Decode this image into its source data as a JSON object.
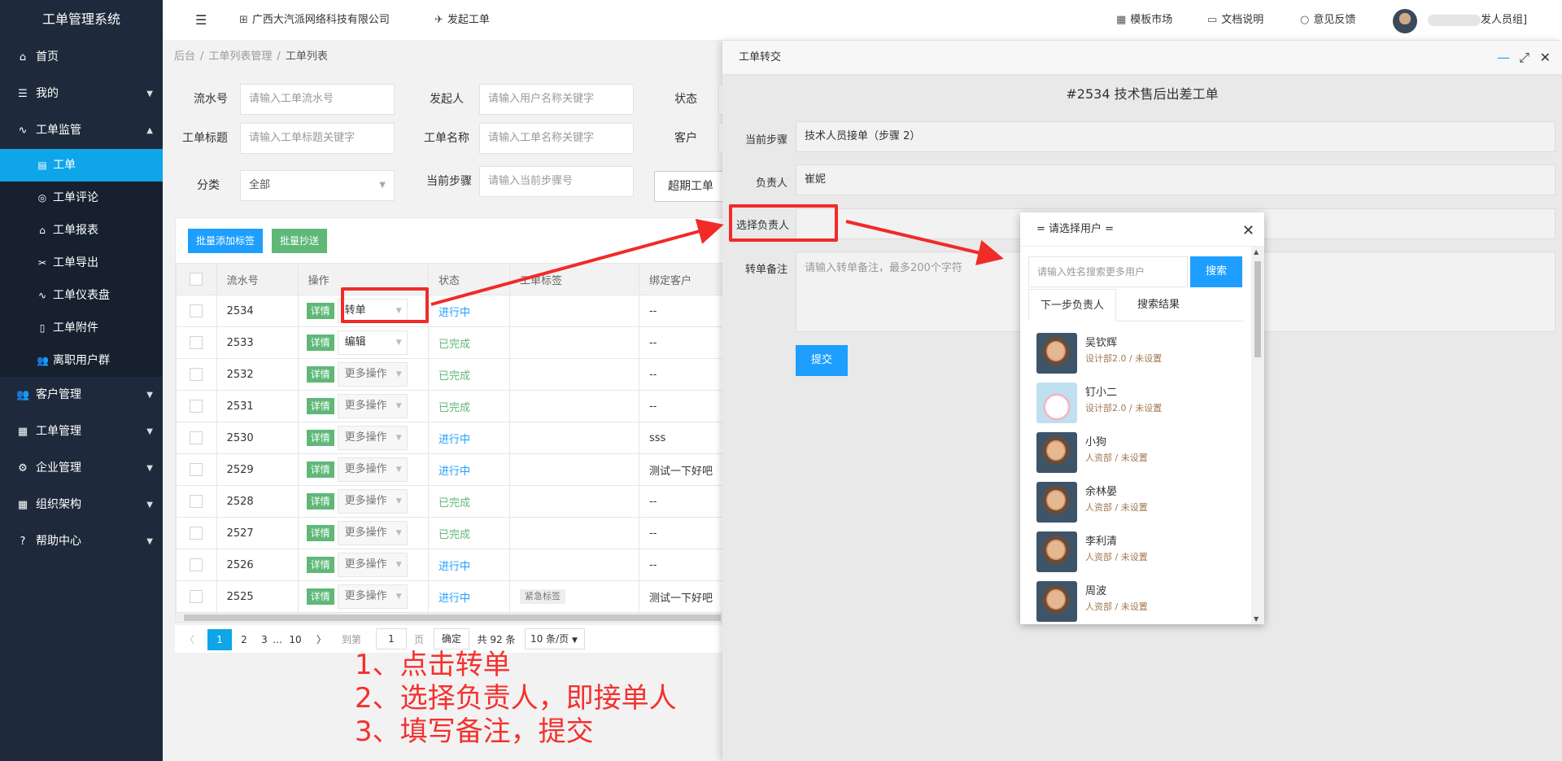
{
  "sidebar": {
    "brand": "工单管理系统",
    "items": [
      {
        "label": "首页",
        "icon": "home-icon"
      },
      {
        "label": "我的",
        "icon": "layers-icon"
      },
      {
        "label": "工单监管",
        "icon": "pulse-icon"
      },
      {
        "label": "客户管理",
        "icon": "users-icon"
      },
      {
        "label": "工单管理",
        "icon": "clipboard-icon"
      },
      {
        "label": "企业管理",
        "icon": "gear-icon"
      },
      {
        "label": "组织架构",
        "icon": "table-icon"
      },
      {
        "label": "帮助中心",
        "icon": "question-icon"
      }
    ],
    "sub_items": [
      {
        "label": "工单",
        "icon": "file-icon"
      },
      {
        "label": "工单评论",
        "icon": "comment-icon"
      },
      {
        "label": "工单报表",
        "icon": "home-icon"
      },
      {
        "label": "工单导出",
        "icon": "export-icon"
      },
      {
        "label": "工单仪表盘",
        "icon": "pulse-icon"
      },
      {
        "label": "工单附件",
        "icon": "file-icon"
      },
      {
        "label": "离职用户群",
        "icon": "users-icon"
      }
    ]
  },
  "topbar": {
    "company": "广西大汽派网络科技有限公司",
    "create": "发起工单",
    "template": "模板市场",
    "docs": "文档说明",
    "feedback": "意见反馈",
    "user": "发人员组]"
  },
  "breadcrumb": [
    "后台",
    "工单列表管理",
    "工单列表"
  ],
  "filters": {
    "serial_label": "流水号",
    "serial_ph": "请输入工单流水号",
    "initiator_label": "发起人",
    "initiator_ph": "请输入用户名称关键字",
    "status_label": "状态",
    "title_label": "工单标题",
    "title_ph": "请输入工单标题关键字",
    "name_label": "工单名称",
    "name_ph": "请输入工单名称关键字",
    "customer_label": "客户",
    "category_label": "分类",
    "category_value": "全部",
    "step_label": "当前步骤",
    "step_ph": "请输入当前步骤号",
    "overdue_btn": "超期工单"
  },
  "toolbar": {
    "add_tag": "批量添加标签",
    "cc": "批量抄送"
  },
  "table": {
    "headers": [
      "流水号",
      "操作",
      "状态",
      "工单标签",
      "绑定客户"
    ],
    "detail_label": "详情",
    "rows": [
      {
        "id": "2534",
        "op": "转单",
        "status": "进行中",
        "tag": "",
        "customer": "--"
      },
      {
        "id": "2533",
        "op": "编辑",
        "status": "已完成",
        "tag": "",
        "customer": "--"
      },
      {
        "id": "2532",
        "op": "更多操作",
        "status": "已完成",
        "tag": "",
        "customer": "--"
      },
      {
        "id": "2531",
        "op": "更多操作",
        "status": "已完成",
        "tag": "",
        "customer": "--"
      },
      {
        "id": "2530",
        "op": "更多操作",
        "status": "进行中",
        "tag": "",
        "customer": "sss"
      },
      {
        "id": "2529",
        "op": "更多操作",
        "status": "进行中",
        "tag": "",
        "customer": "测试一下好吧"
      },
      {
        "id": "2528",
        "op": "更多操作",
        "status": "已完成",
        "tag": "",
        "customer": "--"
      },
      {
        "id": "2527",
        "op": "更多操作",
        "status": "已完成",
        "tag": "",
        "customer": "--"
      },
      {
        "id": "2526",
        "op": "更多操作",
        "status": "进行中",
        "tag": "",
        "customer": "--"
      },
      {
        "id": "2525",
        "op": "更多操作",
        "status": "进行中",
        "tag": "紧急标签",
        "customer": "测试一下好吧"
      }
    ]
  },
  "pager": {
    "prev": "〈",
    "p1": "1",
    "p2": "2",
    "p3": "3",
    "ellipsis": "…",
    "p10": "10",
    "next": "〉",
    "goto": "到第",
    "goto_value": "1",
    "page_unit": "页",
    "confirm": "确定",
    "total": "共 92 条",
    "per_page": "10 条/页"
  },
  "annotations": [
    "1、点击转单",
    "2、选择负责人，即接单人",
    "3、填写备注，提交"
  ],
  "panel": {
    "title": "工单转交",
    "ticket": "#2534 技术售后出差工单",
    "step_label": "当前步骤",
    "step_value": "技术人员接单（步骤 2）",
    "owner_label": "负责人",
    "owner_value": "崔妮",
    "select_label": "选择负责人",
    "note_label": "转单备注",
    "note_ph": "请输入转单备注，最多200个字符",
    "submit": "提交"
  },
  "dialog": {
    "title": "= 请选择用户 =",
    "search_ph": "请输入姓名搜索更多用户",
    "search_btn": "搜索",
    "tab_next": "下一步负责人",
    "tab_results": "搜索结果",
    "users": [
      {
        "name": "吴钦辉",
        "dept": "设计部2.0 / 未设置",
        "avatar": "kid"
      },
      {
        "name": "钉小二",
        "dept": "设计部2.0 / 未设置",
        "avatar": "cat"
      },
      {
        "name": "小狗",
        "dept": "人资部 / 未设置",
        "avatar": "kid"
      },
      {
        "name": "余林晏",
        "dept": "人资部 / 未设置",
        "avatar": "kid"
      },
      {
        "name": "李利清",
        "dept": "人资部 / 未设置",
        "avatar": "kid"
      },
      {
        "name": "周波",
        "dept": "人资部 / 未设置",
        "avatar": "kid"
      }
    ]
  }
}
